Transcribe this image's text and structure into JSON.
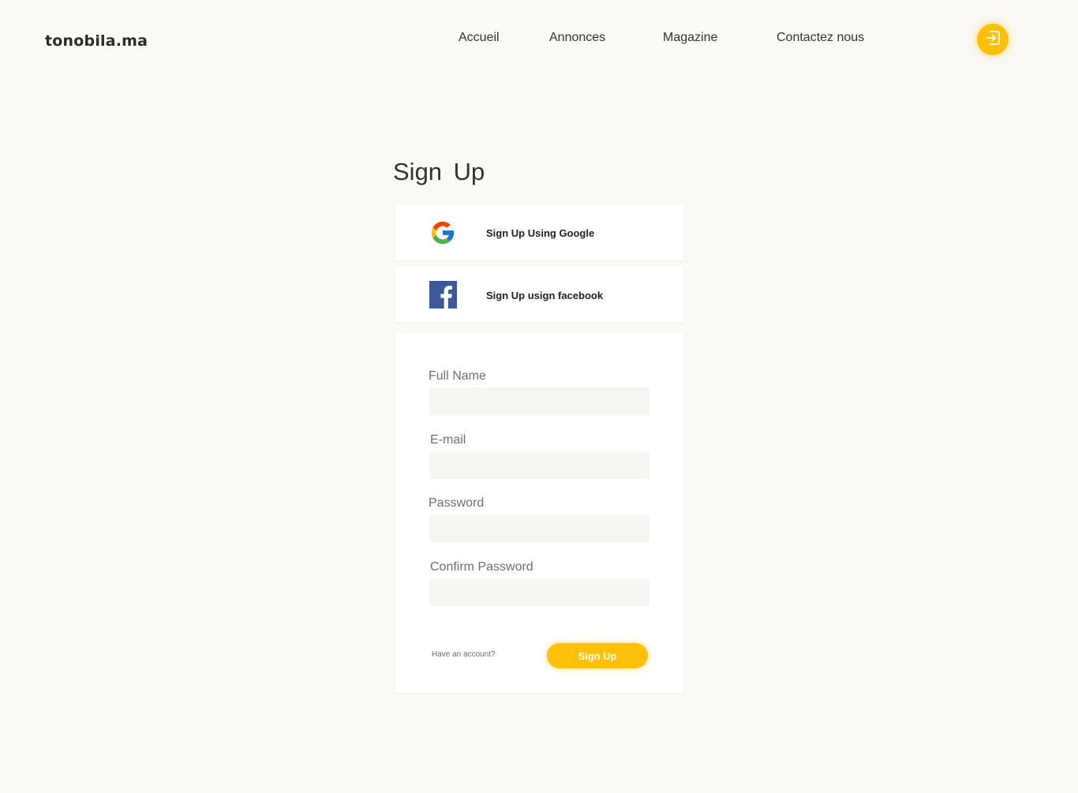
{
  "brand": {
    "logo": "tonobila.ma"
  },
  "nav": {
    "items": [
      {
        "label": "Accueil"
      },
      {
        "label": "Annonces"
      },
      {
        "label": "Magazine"
      },
      {
        "label": "Contactez nous"
      }
    ],
    "login_icon": "login-icon"
  },
  "page": {
    "title": "Sign  Up"
  },
  "social": {
    "google": {
      "label": "Sign Up Using Google",
      "icon": "google-icon"
    },
    "facebook": {
      "label": "Sign Up usign facebook",
      "icon": "facebook-icon"
    }
  },
  "form": {
    "fields": [
      {
        "label": "Full Name",
        "value": ""
      },
      {
        "label": "E-mail",
        "value": ""
      },
      {
        "label": "Password",
        "value": ""
      },
      {
        "label": "Confirm Password",
        "value": ""
      }
    ],
    "have_account": "Have an account?",
    "submit_label": "Sign Up"
  },
  "colors": {
    "accent": "#ffc107",
    "background": "#faf9f6",
    "input_bg": "#f7f6f2",
    "facebook_blue": "#3b5998"
  }
}
